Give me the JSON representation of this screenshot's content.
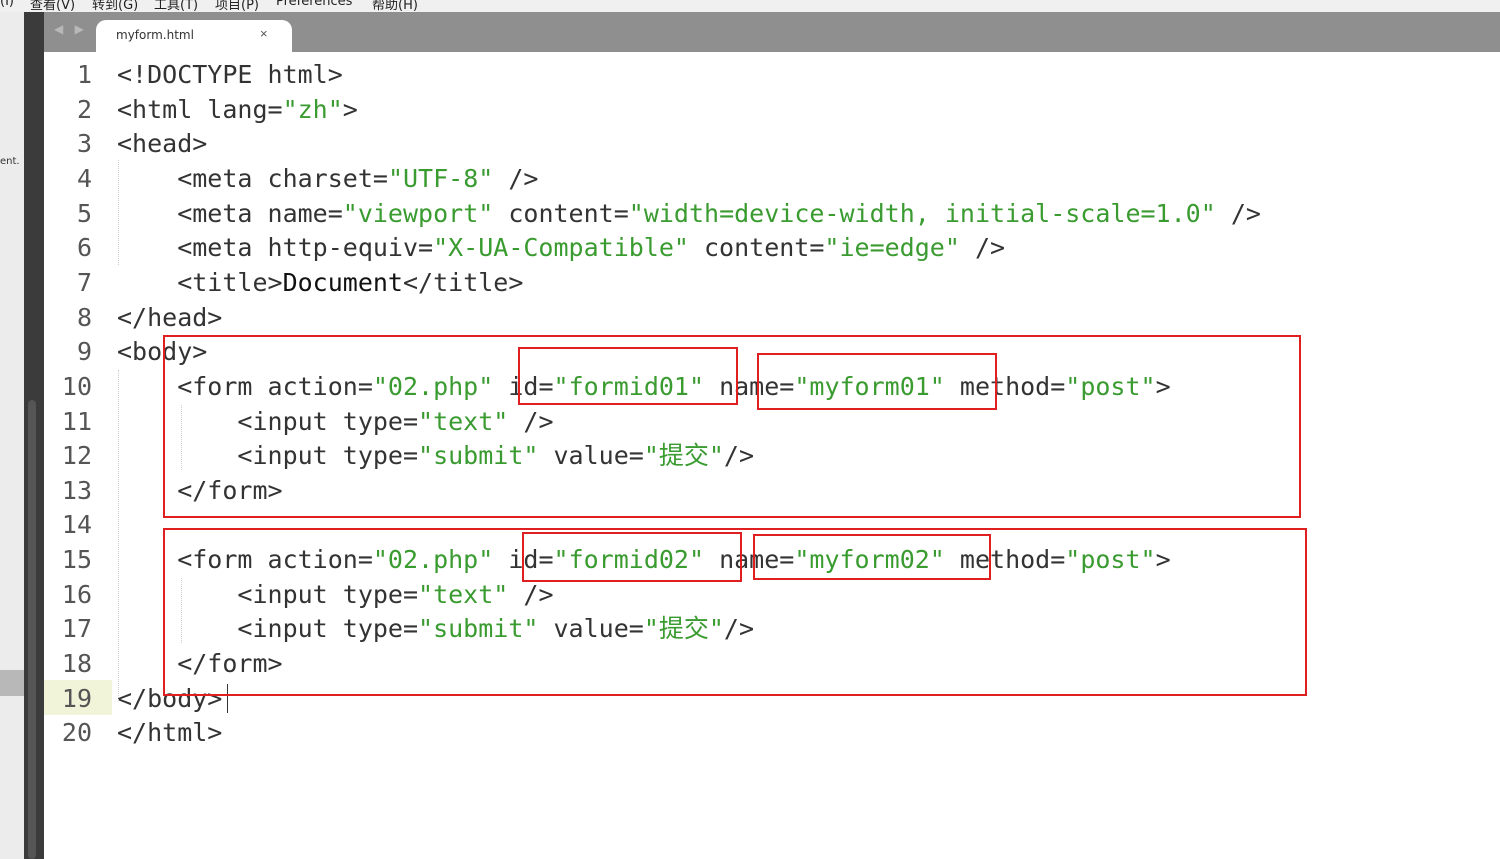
{
  "menubar": {
    "items": [
      "(I)",
      "查看(V)",
      "转到(G)",
      "工具(T)",
      "项目(P)",
      "Preferences",
      "帮助(H)"
    ]
  },
  "sidebar": {
    "label": "ent."
  },
  "tab": {
    "title": "myform.html",
    "close": "×",
    "nav": "◀ ▶"
  },
  "editor": {
    "current_line": 19,
    "lines": [
      {
        "n": "1",
        "parts": [
          {
            "t": "<!DOCTYPE html>"
          }
        ]
      },
      {
        "n": "2",
        "parts": [
          {
            "t": "<html lang="
          },
          {
            "s": "\"zh\""
          },
          {
            "t": ">"
          }
        ]
      },
      {
        "n": "3",
        "parts": [
          {
            "t": "<head>"
          }
        ]
      },
      {
        "n": "4",
        "parts": [
          {
            "t": "    <meta charset="
          },
          {
            "s": "\"UTF-8\""
          },
          {
            "t": " />"
          }
        ]
      },
      {
        "n": "5",
        "parts": [
          {
            "t": "    <meta name="
          },
          {
            "s": "\"viewport\""
          },
          {
            "t": " content="
          },
          {
            "s": "\"width=device-width, initial-scale=1.0\""
          },
          {
            "t": " />"
          }
        ]
      },
      {
        "n": "6",
        "parts": [
          {
            "t": "    <meta http-equiv="
          },
          {
            "s": "\"X-UA-Compatible\""
          },
          {
            "t": " content="
          },
          {
            "s": "\"ie=edge\""
          },
          {
            "t": " />"
          }
        ]
      },
      {
        "n": "7",
        "parts": [
          {
            "t": "    <title>"
          },
          {
            "x": "Document"
          },
          {
            "t": "</title>"
          }
        ]
      },
      {
        "n": "8",
        "parts": [
          {
            "t": "</head>"
          }
        ]
      },
      {
        "n": "9",
        "parts": [
          {
            "t": "<body>"
          }
        ]
      },
      {
        "n": "10",
        "parts": [
          {
            "t": "    <form action="
          },
          {
            "s": "\"02.php\""
          },
          {
            "t": " id="
          },
          {
            "s": "\"formid01\""
          },
          {
            "t": " name="
          },
          {
            "s": "\"myform01\""
          },
          {
            "t": " method="
          },
          {
            "s": "\"post\""
          },
          {
            "t": ">"
          }
        ]
      },
      {
        "n": "11",
        "parts": [
          {
            "t": "        <input type="
          },
          {
            "s": "\"text\""
          },
          {
            "t": " />"
          }
        ]
      },
      {
        "n": "12",
        "parts": [
          {
            "t": "        <input type="
          },
          {
            "s": "\"submit\""
          },
          {
            "t": " value="
          },
          {
            "s": "\"提交\""
          },
          {
            "t": "/>"
          }
        ]
      },
      {
        "n": "13",
        "parts": [
          {
            "t": "    </form>"
          }
        ]
      },
      {
        "n": "14",
        "parts": [
          {
            "t": ""
          }
        ]
      },
      {
        "n": "15",
        "parts": [
          {
            "t": "    <form action="
          },
          {
            "s": "\"02.php\""
          },
          {
            "t": " id="
          },
          {
            "s": "\"formid02\""
          },
          {
            "t": " name="
          },
          {
            "s": "\"myform02\""
          },
          {
            "t": " method="
          },
          {
            "s": "\"post\""
          },
          {
            "t": ">"
          }
        ]
      },
      {
        "n": "16",
        "parts": [
          {
            "t": "        <input type="
          },
          {
            "s": "\"text\""
          },
          {
            "t": " />"
          }
        ]
      },
      {
        "n": "17",
        "parts": [
          {
            "t": "        <input type="
          },
          {
            "s": "\"submit\""
          },
          {
            "t": " value="
          },
          {
            "s": "\"提交\""
          },
          {
            "t": "/>"
          }
        ]
      },
      {
        "n": "18",
        "parts": [
          {
            "t": "    </form>"
          }
        ]
      },
      {
        "n": "19",
        "parts": [
          {
            "t": "</body>"
          }
        ]
      },
      {
        "n": "20",
        "parts": [
          {
            "t": "</html>"
          }
        ]
      }
    ]
  },
  "colors": {
    "string": "#3a9b30",
    "tag": "#333333",
    "annotation": "#e02020"
  }
}
